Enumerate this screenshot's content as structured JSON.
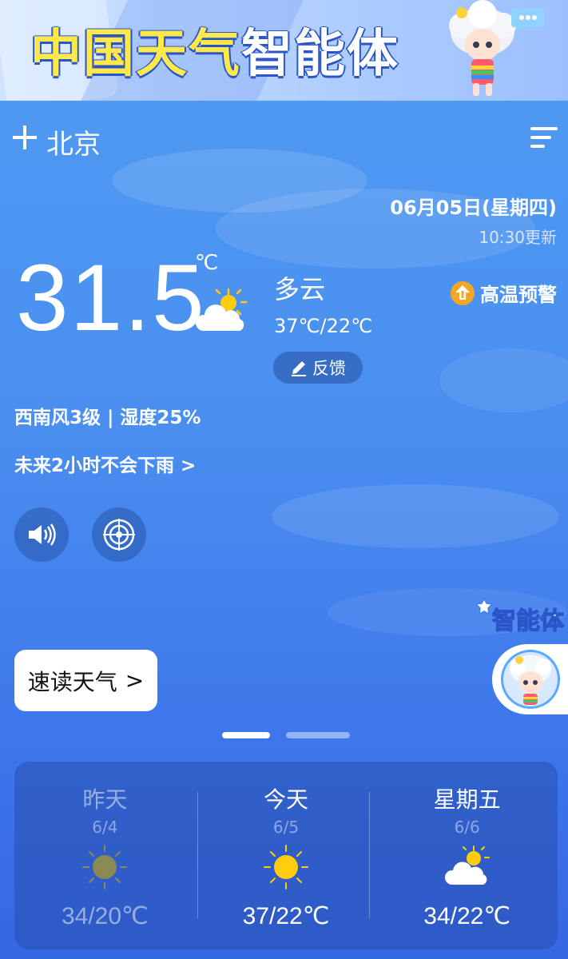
{
  "banner": {
    "title_yellow": "中国天气",
    "title_white": "智能体"
  },
  "header": {
    "city": "北京"
  },
  "current": {
    "date": "06月05日(星期四)",
    "updated": "10:30更新",
    "temperature": "31.5",
    "unit": "℃",
    "condition": "多云",
    "range": "37℃/22℃",
    "feedback_label": "反馈",
    "warning": "高温预警",
    "wind_humidity": "西南风3级 | 湿度25%",
    "rain_forecast": "未来2小时不会下雨 >"
  },
  "quick_read": {
    "label": "速读天气",
    "arrow": ">"
  },
  "agent": {
    "label": "智能体"
  },
  "forecast": [
    {
      "name": "昨天",
      "date": "6/4",
      "range": "34/20℃",
      "icon": "sun-icon"
    },
    {
      "name": "今天",
      "date": "6/5",
      "range": "37/22℃",
      "icon": "sun-icon"
    },
    {
      "name": "星期五",
      "date": "6/6",
      "range": "34/22℃",
      "icon": "partly-cloudy-icon"
    }
  ],
  "colors": {
    "sun": "#ffcc10",
    "sun_past": "#8a8a55",
    "warning": "#f5a623",
    "banner_yellow": "#ffe94a"
  },
  "pager": {
    "current_page": 1,
    "total_pages": 2
  }
}
